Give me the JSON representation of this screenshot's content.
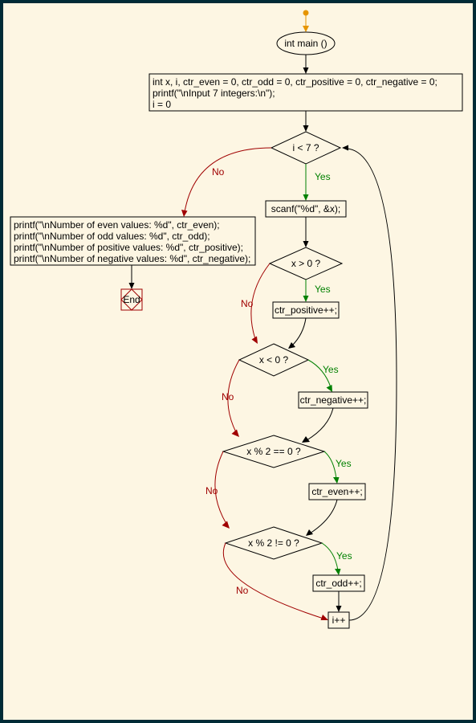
{
  "labels": {
    "yes": "Yes",
    "no": "No"
  },
  "nodes": {
    "main": "int main ()",
    "decl": {
      "l1": "int x, i, ctr_even = 0, ctr_odd = 0, ctr_positive = 0, ctr_negative = 0;",
      "l2": "printf(\"\\nInput 7 integers:\\n\");",
      "l3": "i = 0"
    },
    "cond_loop": "i < 7 ?",
    "scanf": "scanf(\"%d\", &x);",
    "output": {
      "l1": "printf(\"\\nNumber of even values: %d\", ctr_even);",
      "l2": "printf(\"\\nNumber of odd values: %d\", ctr_odd);",
      "l3": "printf(\"\\nNumber of positive values: %d\", ctr_positive);",
      "l4": "printf(\"\\nNumber of negative values: %d\", ctr_negative);"
    },
    "end": "End",
    "cond_pos": "x > 0 ?",
    "ctr_pos": "ctr_positive++;",
    "cond_neg": "x < 0 ?",
    "ctr_neg": "ctr_negative++;",
    "cond_even": "x % 2 == 0 ?",
    "ctr_even": "ctr_even++;",
    "cond_odd": "x % 2 != 0 ?",
    "ctr_odd": "ctr_odd++;",
    "incr": "i++"
  },
  "chart_data": {
    "type": "flowchart",
    "nodes": [
      {
        "id": "start",
        "shape": "entry"
      },
      {
        "id": "main",
        "shape": "ellipse",
        "label": "int main ()"
      },
      {
        "id": "decl",
        "shape": "rect",
        "label": "int x, i, ctr_even = 0, ctr_odd = 0, ctr_positive = 0, ctr_negative = 0;\nprintf(\"\\nInput 7 integers:\\n\");\ni = 0"
      },
      {
        "id": "cond_loop",
        "shape": "diamond",
        "label": "i < 7 ?"
      },
      {
        "id": "scanf",
        "shape": "rect",
        "label": "scanf(\"%d\", &x);"
      },
      {
        "id": "output",
        "shape": "rect",
        "label": "printf(\"\\nNumber of even values: %d\", ctr_even);\nprintf(\"\\nNumber of odd values: %d\", ctr_odd);\nprintf(\"\\nNumber of positive values: %d\", ctr_positive);\nprintf(\"\\nNumber of negative values: %d\", ctr_negative);"
      },
      {
        "id": "end",
        "shape": "terminator",
        "label": "End"
      },
      {
        "id": "cond_pos",
        "shape": "diamond",
        "label": "x > 0 ?"
      },
      {
        "id": "ctr_pos",
        "shape": "rect",
        "label": "ctr_positive++;"
      },
      {
        "id": "cond_neg",
        "shape": "diamond",
        "label": "x < 0 ?"
      },
      {
        "id": "ctr_neg",
        "shape": "rect",
        "label": "ctr_negative++;"
      },
      {
        "id": "cond_even",
        "shape": "diamond",
        "label": "x % 2 == 0 ?"
      },
      {
        "id": "ctr_even",
        "shape": "rect",
        "label": "ctr_even++;"
      },
      {
        "id": "cond_odd",
        "shape": "diamond",
        "label": "x % 2 != 0 ?"
      },
      {
        "id": "ctr_odd",
        "shape": "rect",
        "label": "ctr_odd++;"
      },
      {
        "id": "incr",
        "shape": "rect",
        "label": "i++"
      }
    ],
    "edges": [
      {
        "from": "start",
        "to": "main"
      },
      {
        "from": "main",
        "to": "decl"
      },
      {
        "from": "decl",
        "to": "cond_loop"
      },
      {
        "from": "cond_loop",
        "to": "scanf",
        "label": "Yes"
      },
      {
        "from": "cond_loop",
        "to": "output",
        "label": "No"
      },
      {
        "from": "output",
        "to": "end"
      },
      {
        "from": "scanf",
        "to": "cond_pos"
      },
      {
        "from": "cond_pos",
        "to": "ctr_pos",
        "label": "Yes"
      },
      {
        "from": "cond_pos",
        "to": "cond_neg",
        "label": "No"
      },
      {
        "from": "ctr_pos",
        "to": "cond_neg"
      },
      {
        "from": "cond_neg",
        "to": "ctr_neg",
        "label": "Yes"
      },
      {
        "from": "cond_neg",
        "to": "cond_even",
        "label": "No"
      },
      {
        "from": "ctr_neg",
        "to": "cond_even"
      },
      {
        "from": "cond_even",
        "to": "ctr_even",
        "label": "Yes"
      },
      {
        "from": "cond_even",
        "to": "cond_odd",
        "label": "No"
      },
      {
        "from": "ctr_even",
        "to": "cond_odd"
      },
      {
        "from": "cond_odd",
        "to": "ctr_odd",
        "label": "Yes"
      },
      {
        "from": "cond_odd",
        "to": "incr",
        "label": "No"
      },
      {
        "from": "ctr_odd",
        "to": "incr"
      },
      {
        "from": "incr",
        "to": "cond_loop"
      }
    ]
  }
}
